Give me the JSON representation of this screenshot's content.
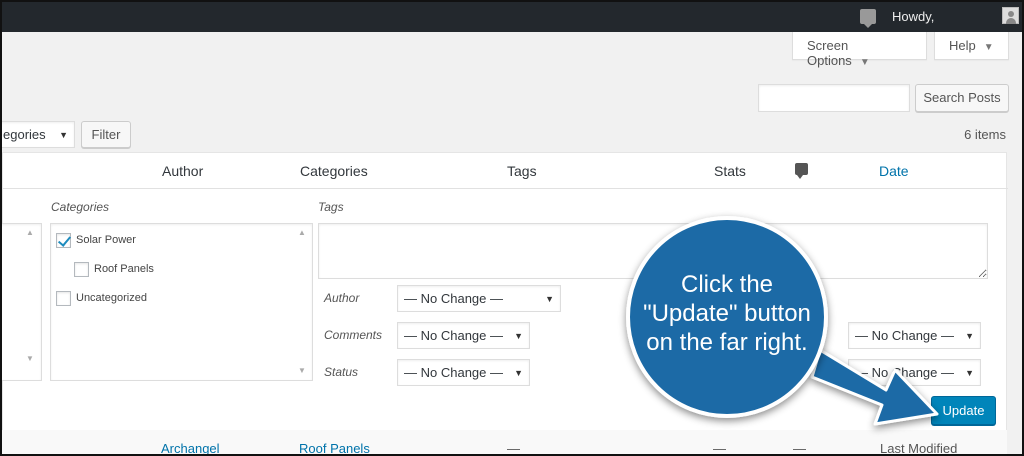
{
  "adminbar": {
    "howdy": "Howdy,"
  },
  "screen_options": {
    "label": "Screen Options",
    "arrow": "▼"
  },
  "help": {
    "label": "Help",
    "arrow": "▼"
  },
  "search": {
    "value": "",
    "button": "Search Posts"
  },
  "filter_bar": {
    "category_select": "egories",
    "filter_button": "Filter",
    "items_count": "6 items"
  },
  "columns": {
    "author": "Author",
    "categories": "Categories",
    "tags": "Tags",
    "stats": "Stats",
    "date": "Date"
  },
  "quick_edit": {
    "categories_label": "Categories",
    "tags_label": "Tags",
    "category_options": [
      {
        "label": "Solar Power",
        "checked": true
      },
      {
        "label": "Roof Panels",
        "checked": false
      },
      {
        "label": "Uncategorized",
        "checked": false
      }
    ],
    "tags_value": "",
    "author_label": "Author",
    "author_select": "— No Change —",
    "comments_label": "Comments",
    "comments_select": "— No Change —",
    "status_label": "Status",
    "status_select": "— No Change —",
    "right_select_1": "— No Change —",
    "right_select_2": "— No Change —",
    "update_button": "Update"
  },
  "next_row": {
    "author": "Archangel",
    "categories": "Roof Panels",
    "tags": "—",
    "stats": "—",
    "comments": "—",
    "date": "Last Modified"
  },
  "callout": {
    "line1": "Click the",
    "line2": "\"Update\" button",
    "line3": "on the far right.",
    "color": "#1a6aa6"
  },
  "colors": {
    "adminbar_bg": "#23282d",
    "link": "#0073aa",
    "primary_button": "#0085ba"
  },
  "icons": [
    "comment-icon",
    "avatar-icon",
    "comment-bubble-icon",
    "checkmark-icon",
    "caret-down-icon"
  ]
}
